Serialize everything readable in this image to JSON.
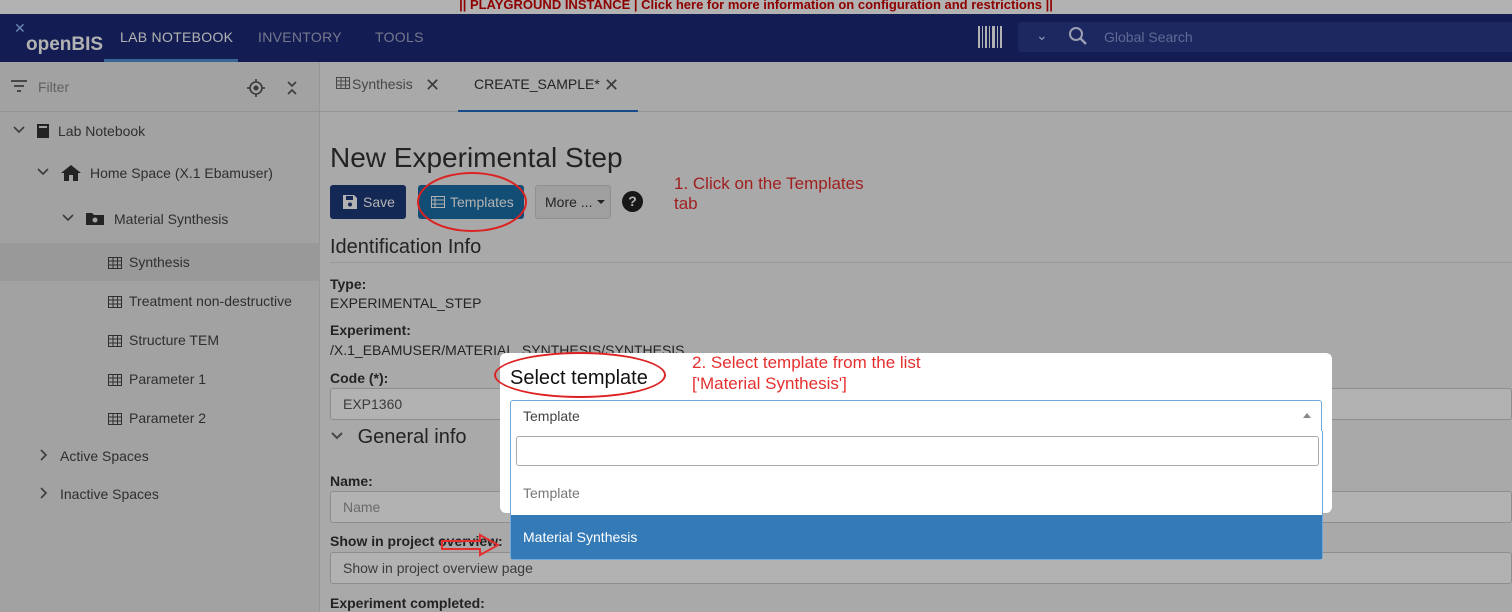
{
  "banner": {
    "text": "|| PLAYGROUND INSTANCE | Click here for more information on configuration and restrictions ||"
  },
  "header": {
    "logo": "openBIS",
    "nav": [
      {
        "label": "LAB NOTEBOOK",
        "active": true
      },
      {
        "label": "INVENTORY",
        "active": false
      },
      {
        "label": "TOOLS",
        "active": false
      }
    ],
    "search_placeholder": "Global Search"
  },
  "sidebar": {
    "filter_placeholder": "Filter",
    "tree": [
      {
        "label": "Lab Notebook",
        "expanded": true,
        "icon": "notebook-icon"
      },
      {
        "label": "Home Space (X.1 Ebamuser)",
        "expanded": true,
        "icon": "home-icon"
      },
      {
        "label": "Material Synthesis",
        "expanded": true,
        "icon": "folder-gear-icon"
      },
      {
        "label": "Synthesis",
        "selected": true,
        "icon": "table-icon"
      },
      {
        "label": "Treatment non-destructive",
        "icon": "table-icon"
      },
      {
        "label": "Structure TEM",
        "icon": "table-icon"
      },
      {
        "label": "Parameter 1",
        "icon": "table-icon"
      },
      {
        "label": "Parameter 2",
        "icon": "table-icon"
      },
      {
        "label": "Active Spaces",
        "expanded": false
      },
      {
        "label": "Inactive Spaces",
        "expanded": false
      }
    ]
  },
  "tabs": [
    {
      "label": "Synthesis",
      "active": false
    },
    {
      "label": "CREATE_SAMPLE*",
      "active": true
    }
  ],
  "form": {
    "title": "New Experimental Step",
    "save_label": "Save",
    "templates_label": "Templates",
    "more_label": "More ...",
    "help_label": "?",
    "identification_title": "Identification Info",
    "type_label": "Type:",
    "type_value": "EXPERIMENTAL_STEP",
    "experiment_label": "Experiment:",
    "experiment_value": "/X.1_EBAMUSER/MATERIAL_SYNTHESIS/SYNTHESIS",
    "code_label": "Code (*):",
    "code_value": "EXP1360",
    "general_title": "General info",
    "name_label": "Name:",
    "name_placeholder": "Name",
    "show_label": "Show in project overview:",
    "show_placeholder": "Show in project overview page",
    "completed_label": "Experiment completed:"
  },
  "annotations": {
    "step1_line1": "1. Click on the Templates",
    "step1_line2": "tab",
    "step2_line1": "2. Select template from the list",
    "step2_line2": "['Material Synthesis']"
  },
  "modal": {
    "title": "Select template",
    "select_value": "Template",
    "options": [
      {
        "label": "Template",
        "highlighted": false
      },
      {
        "label": "Material Synthesis",
        "highlighted": true
      }
    ]
  },
  "colors": {
    "topbar": "#1e2a78",
    "accent": "#337ab7",
    "annotation": "#e52f2f",
    "save_button": "#1e3a7a"
  }
}
